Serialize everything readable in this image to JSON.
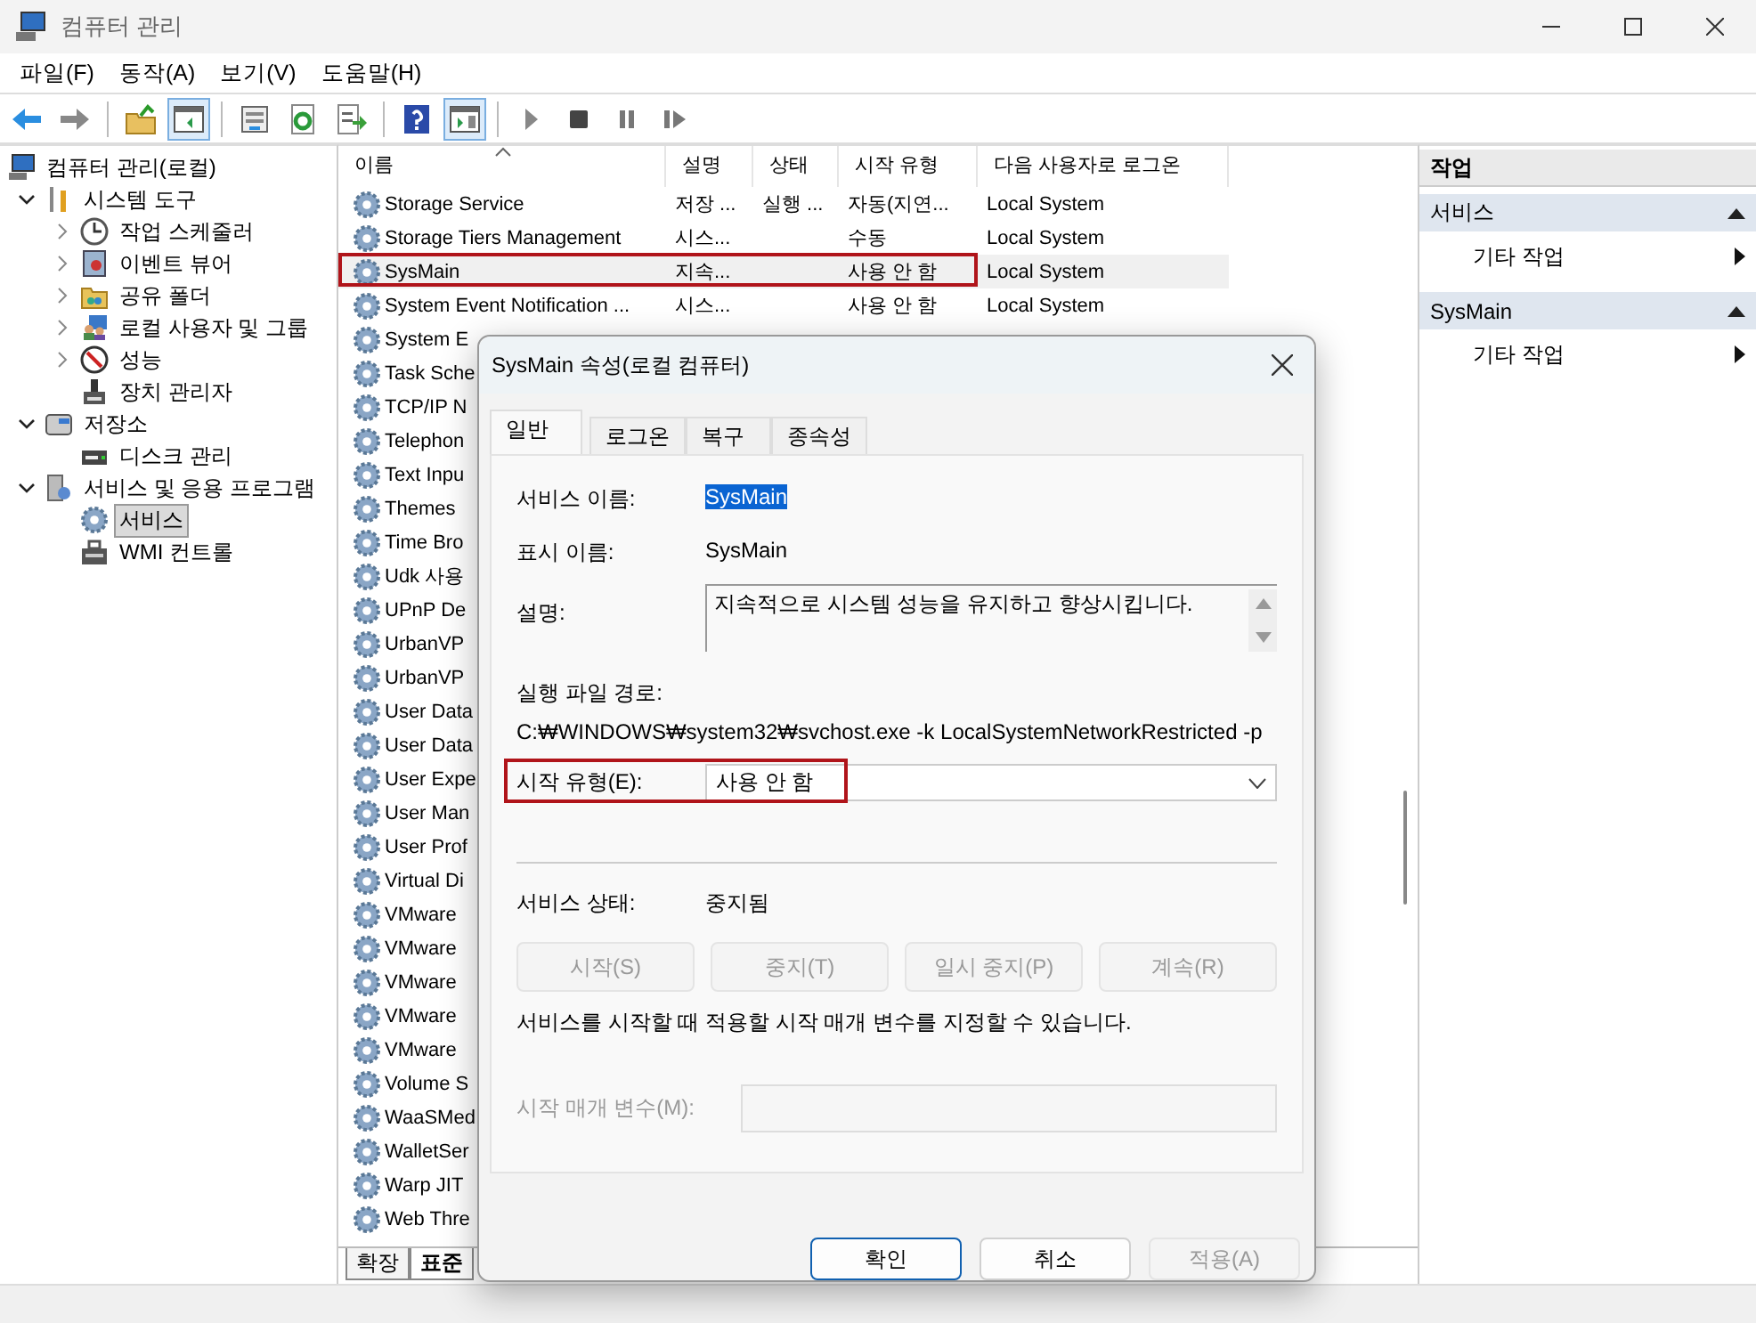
{
  "window": {
    "title": "컴퓨터 관리"
  },
  "menu": [
    "파일(F)",
    "동작(A)",
    "보기(V)",
    "도움말(H)"
  ],
  "toolbar": [
    [
      {
        "kind": "back",
        "pressed": false
      },
      {
        "kind": "forward",
        "pressed": false
      }
    ],
    [
      {
        "kind": "up",
        "pressed": false
      },
      {
        "kind": "tree-toggle",
        "pressed": true
      }
    ],
    [
      {
        "kind": "properties",
        "pressed": false
      },
      {
        "kind": "refresh",
        "pressed": false
      },
      {
        "kind": "export",
        "pressed": false
      }
    ],
    [
      {
        "kind": "help",
        "pressed": false
      },
      {
        "kind": "action-toggle",
        "pressed": true
      }
    ],
    [
      {
        "kind": "play",
        "pressed": false
      },
      {
        "kind": "stop",
        "pressed": false
      },
      {
        "kind": "pause",
        "pressed": false
      },
      {
        "kind": "resume",
        "pressed": false
      }
    ]
  ],
  "tree": [
    {
      "label": "컴퓨터 관리(로컬)",
      "kind": "computer",
      "selected": false,
      "children": [
        {
          "label": "시스템 도구",
          "kind": "tools",
          "expanded": true,
          "selected": false,
          "children": [
            {
              "label": "작업 스케줄러",
              "kind": "clock",
              "expanded": false,
              "selected": false
            },
            {
              "label": "이벤트 뷰어",
              "kind": "event",
              "expanded": false,
              "selected": false
            },
            {
              "label": "공유 폴더",
              "kind": "share",
              "expanded": false,
              "selected": false
            },
            {
              "label": "로컬 사용자 및 그룹",
              "kind": "users",
              "expanded": false,
              "selected": false
            },
            {
              "label": "성능",
              "kind": "perf",
              "expanded": false,
              "selected": false
            },
            {
              "label": "장치 관리자",
              "kind": "device",
              "selected": false
            }
          ]
        },
        {
          "label": "저장소",
          "kind": "storage",
          "expanded": true,
          "selected": false,
          "children": [
            {
              "label": "디스크 관리",
              "kind": "disk",
              "selected": false
            }
          ]
        },
        {
          "label": "서비스 및 응용 프로그램",
          "kind": "apps",
          "expanded": true,
          "selected": false,
          "children": [
            {
              "label": "서비스",
              "kind": "services",
              "selected": true
            },
            {
              "label": "WMI 컨트롤",
              "kind": "wmi",
              "selected": false
            }
          ]
        }
      ]
    }
  ],
  "table": {
    "columns": [
      {
        "label": "이름",
        "sorted": true
      },
      {
        "label": "설명",
        "sorted": false
      },
      {
        "label": "상태",
        "sorted": false
      },
      {
        "label": "시작 유형",
        "sorted": false
      },
      {
        "label": "다음 사용자로 로그온",
        "sorted": false
      }
    ],
    "rows": [
      {
        "name": "Storage Service",
        "description": "저장 ...",
        "status": "실행 ...",
        "startup": "자동(지연...",
        "logon": "Local System",
        "selected": false,
        "marked": false
      },
      {
        "name": "Storage Tiers Management",
        "description": "시스...",
        "startup": "수동",
        "logon": "Local System",
        "selected": false,
        "marked": false
      },
      {
        "name": "SysMain",
        "description": "지속...",
        "startup": "사용 안 함",
        "logon": "Local System",
        "selected": true,
        "marked": true
      },
      {
        "name": "System Event Notification ...",
        "description": "시스...",
        "startup": "사용 안 함",
        "logon": "Local System",
        "selected": false,
        "marked": false
      },
      {
        "name": "System E",
        "selected": false,
        "marked": false
      },
      {
        "name": "Task Sche",
        "selected": false,
        "marked": false
      },
      {
        "name": "TCP/IP N",
        "selected": false,
        "marked": false
      },
      {
        "name": "Telephon",
        "selected": false,
        "marked": false
      },
      {
        "name": "Text Inpu",
        "selected": false,
        "marked": false
      },
      {
        "name": "Themes",
        "selected": false,
        "marked": false
      },
      {
        "name": "Time Bro",
        "selected": false,
        "marked": false
      },
      {
        "name": "Udk 사용",
        "selected": false,
        "marked": false
      },
      {
        "name": "UPnP De",
        "selected": false,
        "marked": false
      },
      {
        "name": "UrbanVP",
        "selected": false,
        "marked": false
      },
      {
        "name": "UrbanVP",
        "selected": false,
        "marked": false
      },
      {
        "name": "User Data",
        "selected": false,
        "marked": false
      },
      {
        "name": "User Data",
        "selected": false,
        "marked": false
      },
      {
        "name": "User Expe",
        "selected": false,
        "marked": false
      },
      {
        "name": "User Man",
        "selected": false,
        "marked": false
      },
      {
        "name": "User Prof",
        "selected": false,
        "marked": false
      },
      {
        "name": "Virtual Di",
        "selected": false,
        "marked": false
      },
      {
        "name": "VMware",
        "selected": false,
        "marked": false
      },
      {
        "name": "VMware",
        "selected": false,
        "marked": false
      },
      {
        "name": "VMware",
        "selected": false,
        "marked": false
      },
      {
        "name": "VMware",
        "selected": false,
        "marked": false
      },
      {
        "name": "VMware",
        "selected": false,
        "marked": false
      },
      {
        "name": "Volume S",
        "selected": false,
        "marked": false
      },
      {
        "name": "WaaSMed",
        "selected": false,
        "marked": false
      },
      {
        "name": "WalletSer",
        "selected": false,
        "marked": false
      },
      {
        "name": "Warp JIT",
        "selected": false,
        "marked": false
      },
      {
        "name": "Web Thre",
        "selected": false,
        "marked": false
      }
    ]
  },
  "view_tabs": [
    {
      "label": "확장",
      "selected": false
    },
    {
      "label": "표준",
      "selected": true
    }
  ],
  "actions": {
    "title": "작업",
    "sections": [
      {
        "title": "서비스",
        "items": [
          "기타 작업"
        ]
      },
      {
        "title": "SysMain",
        "items": [
          "기타 작업"
        ]
      }
    ]
  },
  "dialog": {
    "title": "SysMain 속성(로컬 컴퓨터)",
    "tabs": [
      {
        "label": "일반",
        "selected": true
      },
      {
        "label": "로그온",
        "selected": false
      },
      {
        "label": "복구",
        "selected": false
      },
      {
        "label": "종속성",
        "selected": false
      }
    ],
    "service_name": {
      "label": "서비스 이름:",
      "value": "SysMain"
    },
    "display_name": {
      "label": "표시 이름:",
      "value": "SysMain"
    },
    "description": {
      "label": "설명:",
      "value": "지속적으로 시스템 성능을 유지하고 향상시킵니다."
    },
    "path": {
      "label": "실행 파일 경로:",
      "value": "C:₩WINDOWS₩system32₩svchost.exe -k LocalSystemNetworkRestricted -p"
    },
    "startup_type": {
      "label": "시작 유형(E):",
      "value": "사용 안 함",
      "marked": true
    },
    "status": {
      "label": "서비스 상태:",
      "value": "중지됨"
    },
    "control_buttons": [
      {
        "label": "시작(S)",
        "disabled": true
      },
      {
        "label": "중지(T)",
        "disabled": true
      },
      {
        "label": "일시 중지(P)",
        "disabled": true
      },
      {
        "label": "계속(R)",
        "disabled": true
      }
    ],
    "hint": "서비스를 시작할 때 적용할 시작 매개 변수를 지정할 수 있습니다.",
    "start_params": {
      "label": "시작 매개 변수(M):",
      "disabled": true
    },
    "buttons": [
      {
        "label": "확인",
        "default": true,
        "disabled": false
      },
      {
        "label": "취소",
        "default": false,
        "disabled": false
      },
      {
        "label": "적용(A)",
        "default": false,
        "disabled": true
      }
    ]
  }
}
